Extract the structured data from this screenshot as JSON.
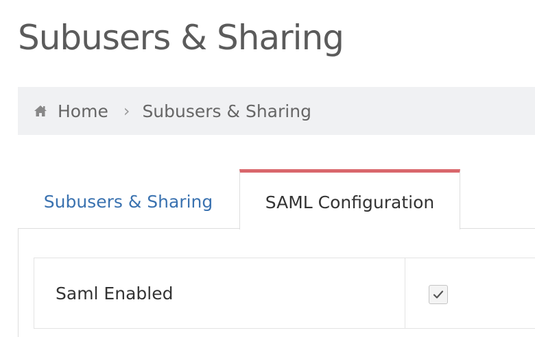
{
  "page": {
    "title": "Subusers & Sharing"
  },
  "breadcrumb": {
    "home_icon": "home-icon",
    "home_label": "Home",
    "separator": "›",
    "current_label": "Subusers & Sharing"
  },
  "tabs": [
    {
      "label": "Subusers & Sharing",
      "active": false
    },
    {
      "label": "SAML Configuration",
      "active": true
    }
  ],
  "settings": {
    "rows": [
      {
        "label": "Saml Enabled",
        "checked": true,
        "icon": "checkmark-icon"
      }
    ]
  },
  "colors": {
    "active_tab_accent": "#d9676c",
    "link": "#3a72b0",
    "breadcrumb_bg": "#f0f1f3"
  }
}
